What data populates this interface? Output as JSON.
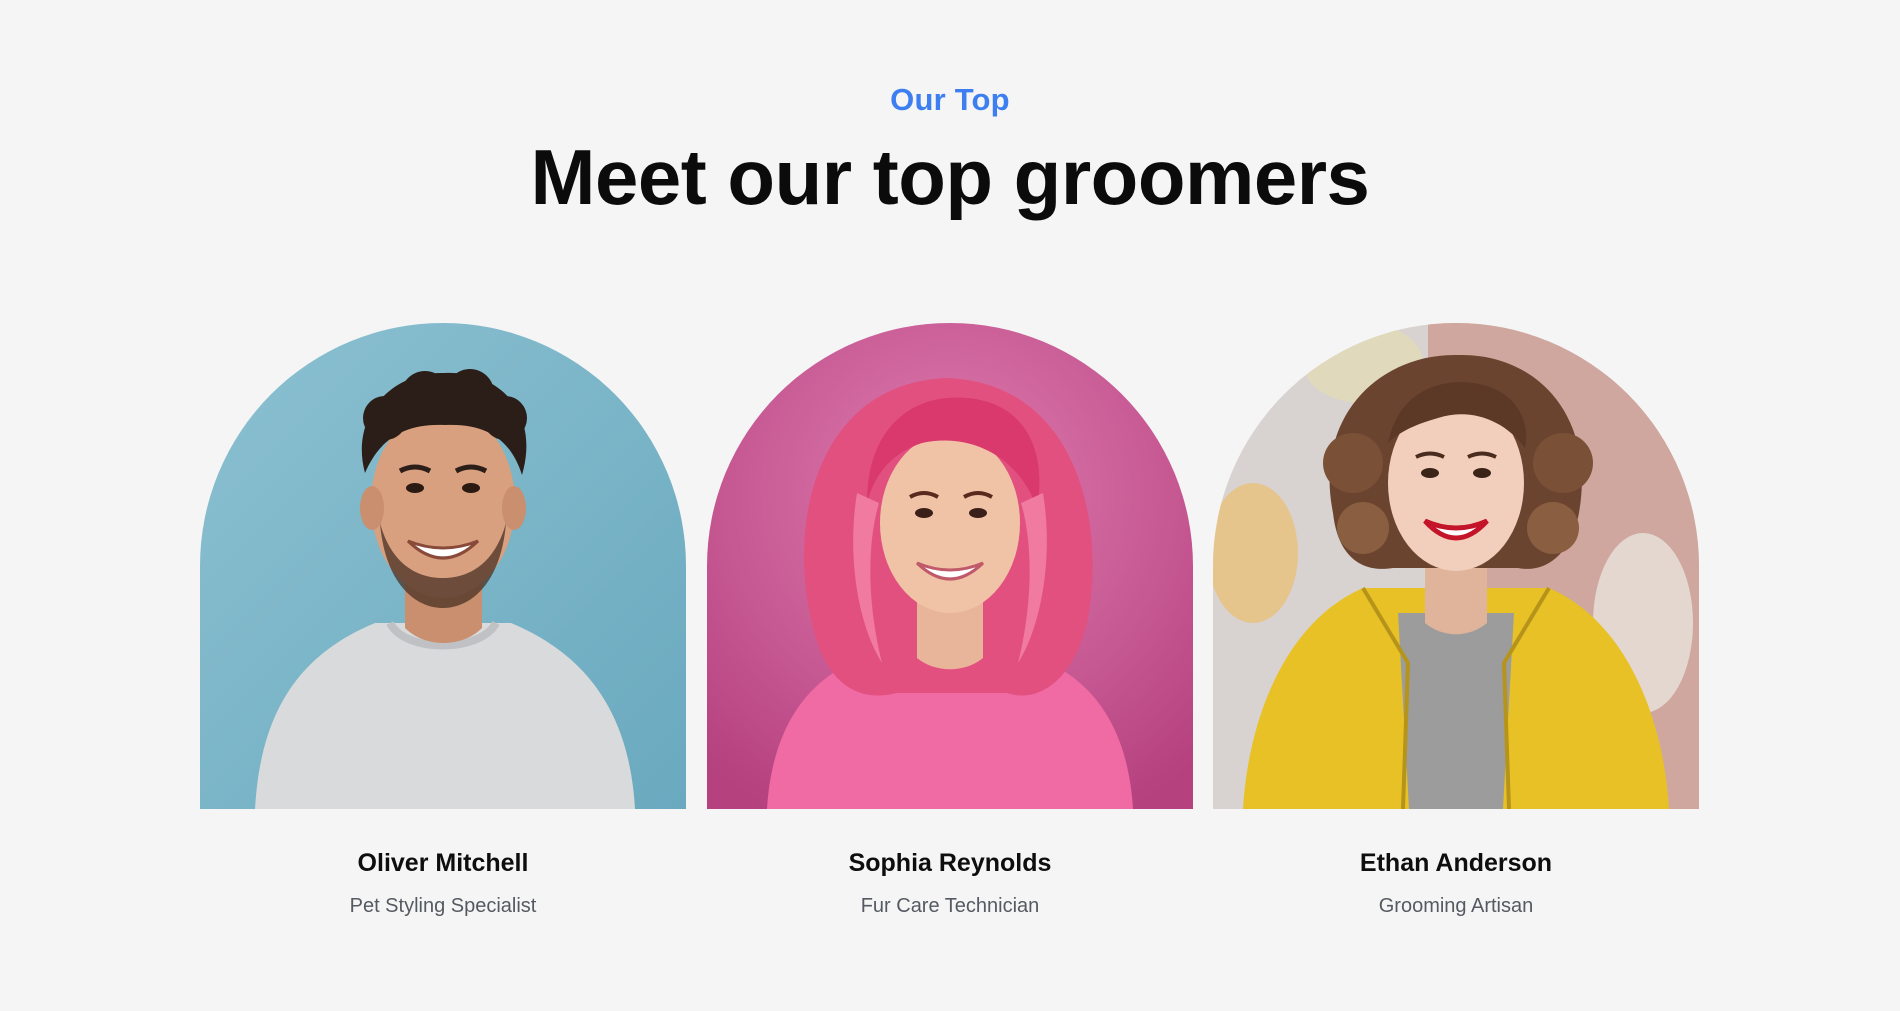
{
  "section": {
    "eyebrow": "Our Top",
    "title": "Meet our top groomers"
  },
  "groomers": [
    {
      "name": "Oliver Mitchell",
      "role": "Pet Styling Specialist",
      "photo": "portrait-oliver-mitchell",
      "background_color": "#7fb7c9"
    },
    {
      "name": "Sophia Reynolds",
      "role": "Fur Care Technician",
      "photo": "portrait-sophia-reynolds",
      "background_color": "#d4619a"
    },
    {
      "name": "Ethan Anderson",
      "role": "Grooming Artisan",
      "photo": "portrait-ethan-anderson",
      "background_color": "#d3c6c3"
    }
  ],
  "colors": {
    "accent": "#3d7ff0",
    "page_background": "#f5f5f5",
    "heading": "#0b0b0b",
    "subtext": "#555a62"
  }
}
